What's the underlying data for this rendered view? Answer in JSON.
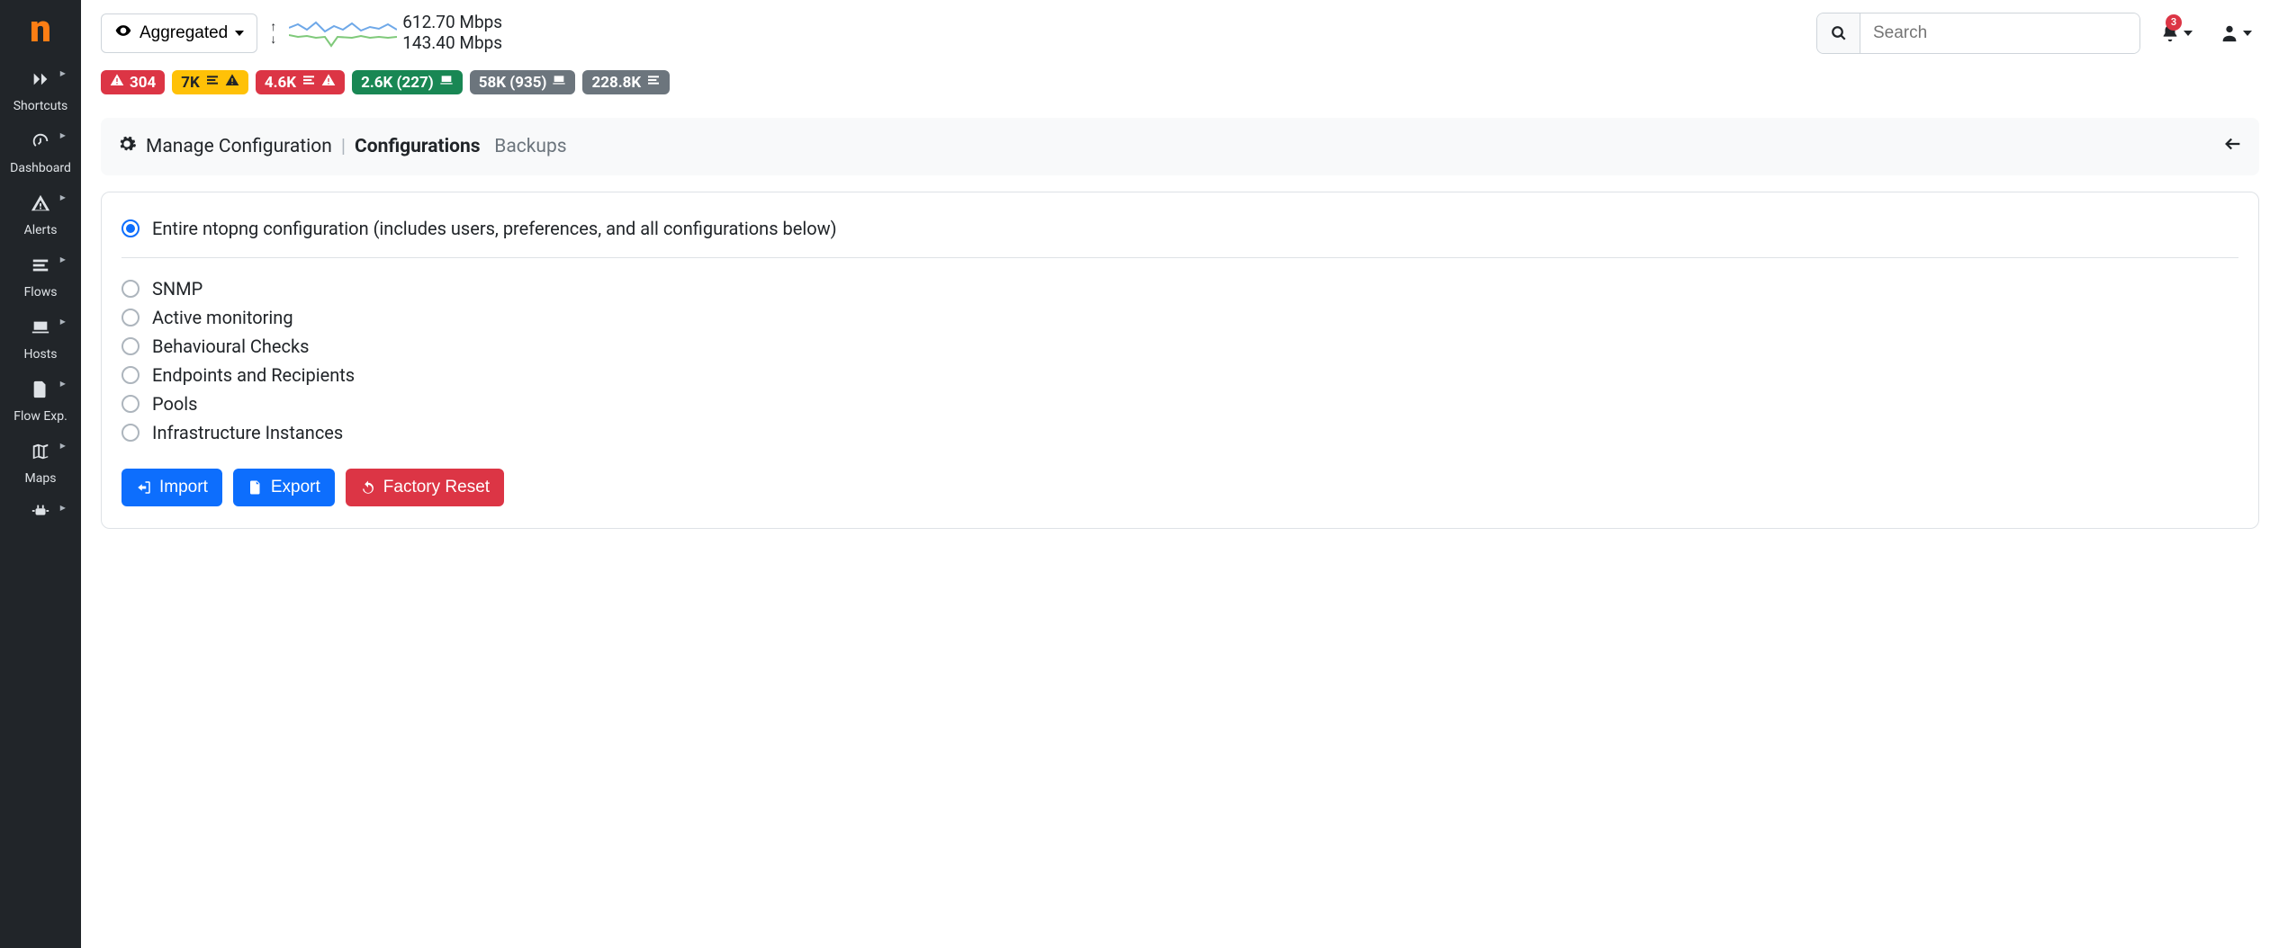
{
  "brand": {
    "letter": "n"
  },
  "sidebar": {
    "items": [
      {
        "id": "shortcuts",
        "label": "Shortcuts",
        "icon": "forward-icon"
      },
      {
        "id": "dashboard",
        "label": "Dashboard",
        "icon": "gauge-icon"
      },
      {
        "id": "alerts",
        "label": "Alerts",
        "icon": "warning-icon"
      },
      {
        "id": "flows",
        "label": "Flows",
        "icon": "stream-icon"
      },
      {
        "id": "hosts",
        "label": "Hosts",
        "icon": "laptop-icon"
      },
      {
        "id": "flowexp",
        "label": "Flow Exp.",
        "icon": "file-export-icon"
      },
      {
        "id": "maps",
        "label": "Maps",
        "icon": "map-icon"
      }
    ]
  },
  "top": {
    "aggregated_label": "Aggregated",
    "traffic_down": "612.70 Mbps",
    "traffic_up": "143.40 Mbps",
    "search_placeholder": "Search",
    "notif_count": "3"
  },
  "badges": [
    {
      "text": "304",
      "color": "bg-red",
      "icons": [
        "warn"
      ]
    },
    {
      "text": "7K",
      "color": "bg-yellow",
      "icons": [
        "stream",
        "warn"
      ]
    },
    {
      "text": "4.6K",
      "color": "bg-red",
      "icons": [
        "stream",
        "warn"
      ]
    },
    {
      "text": "2.6K (227)",
      "color": "bg-green",
      "icons": [
        "laptop"
      ]
    },
    {
      "text": "58K (935)",
      "color": "bg-gray",
      "icons": [
        "laptop"
      ]
    },
    {
      "text": "228.8K",
      "color": "bg-gray",
      "icons": [
        "stream"
      ]
    }
  ],
  "page": {
    "title": "Manage Configuration",
    "tabs": [
      {
        "label": "Configurations",
        "active": true
      },
      {
        "label": "Backups",
        "active": false
      }
    ]
  },
  "options": {
    "primary": "Entire ntopng configuration (includes users, preferences, and all configurations below)",
    "list": [
      "SNMP",
      "Active monitoring",
      "Behavioural Checks",
      "Endpoints and Recipients",
      "Pools",
      "Infrastructure Instances"
    ]
  },
  "buttons": {
    "import": "Import",
    "export": "Export",
    "reset": "Factory Reset"
  }
}
